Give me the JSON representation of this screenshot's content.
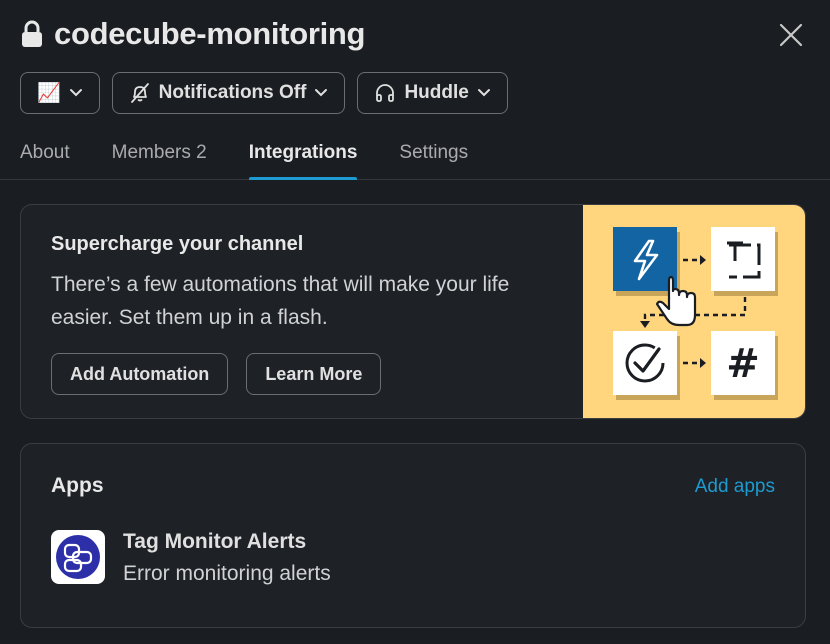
{
  "header": {
    "channel_name": "codecube-monitoring",
    "pills": {
      "chart_emoji": "📈",
      "notifications_label": "Notifications Off",
      "huddle_label": "Huddle"
    }
  },
  "tabs": [
    {
      "label": "About"
    },
    {
      "label": "Members 2"
    },
    {
      "label": "Integrations",
      "active": true
    },
    {
      "label": "Settings"
    }
  ],
  "promo": {
    "title": "Supercharge your channel",
    "body": "There’s a few automations that will make your life easier. Set them up in a flash.",
    "add_automation_label": "Add Automation",
    "learn_more_label": "Learn More"
  },
  "apps": {
    "title": "Apps",
    "add_apps_label": "Add apps",
    "items": [
      {
        "name": "Tag Monitor Alerts",
        "description": "Error monitoring alerts"
      }
    ]
  },
  "colors": {
    "background": "#1a1d21",
    "accent": "#1d9bd1",
    "illustration_bg": "#ffd57e",
    "app_icon": "#2c2fa8"
  }
}
